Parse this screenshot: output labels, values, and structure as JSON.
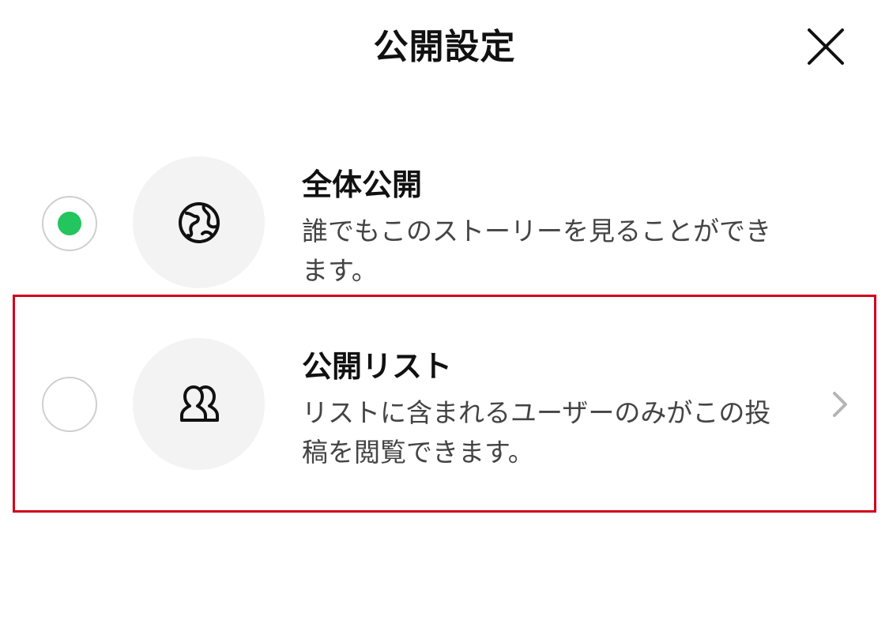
{
  "header": {
    "title": "公開設定"
  },
  "options": [
    {
      "id": "public",
      "title": "全体公開",
      "description": "誰でもこのストーリーを見ることができます。",
      "selected": true,
      "icon": "globe-icon"
    },
    {
      "id": "public-list",
      "title": "公開リスト",
      "description": "リストに含まれるユーザーのみがこの投稿を閲覧できます。",
      "selected": false,
      "icon": "users-icon",
      "has_chevron": true
    }
  ],
  "colors": {
    "radio_selected": "#22c55e",
    "highlight_border": "#d0021b",
    "icon_circle_bg": "#f3f3f3"
  }
}
